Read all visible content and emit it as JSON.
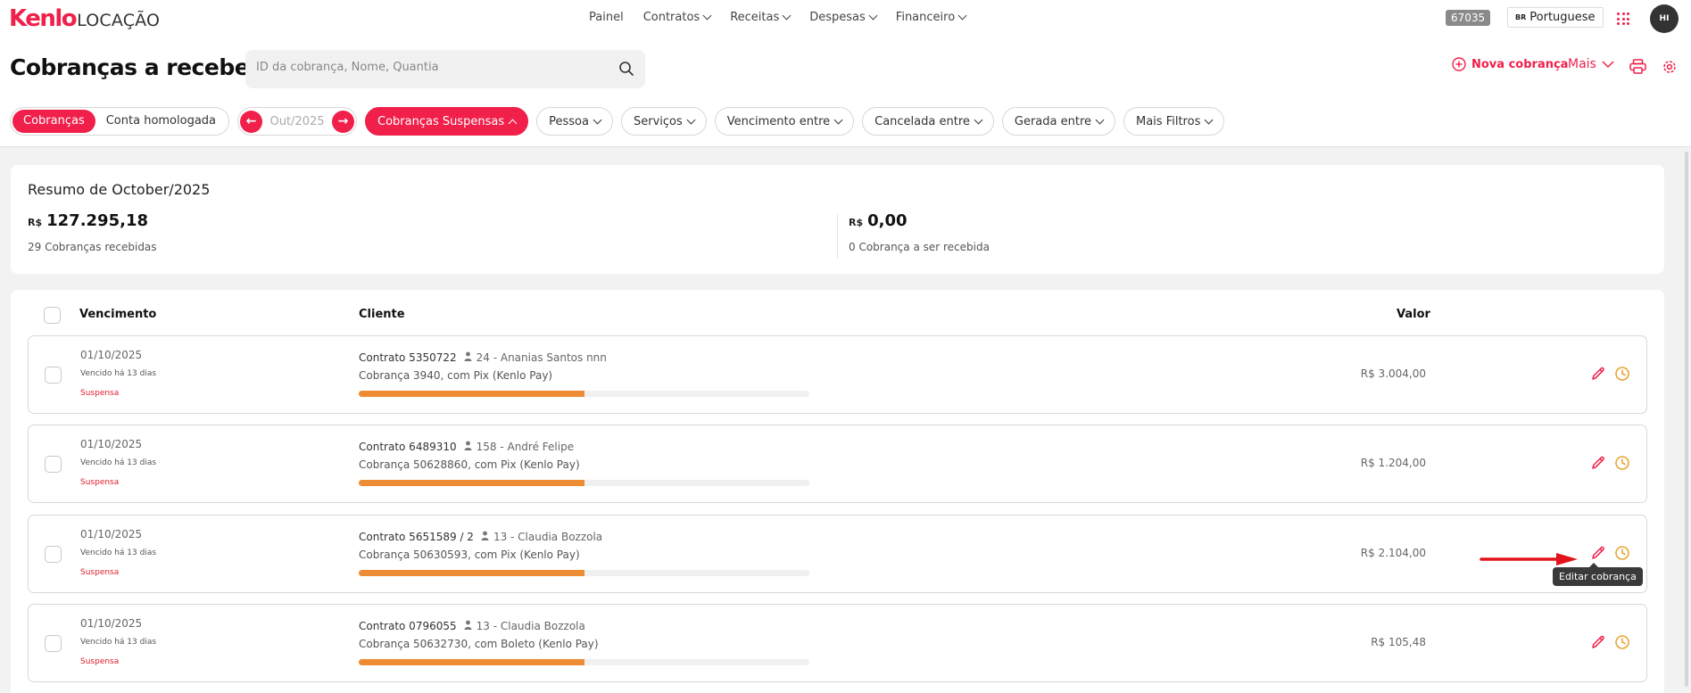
{
  "app": {
    "logo_brand": "Kenlo",
    "logo_product": "LOCAÇÃO"
  },
  "nav": [
    {
      "label": "Painel"
    },
    {
      "label": "Contratos"
    },
    {
      "label": "Receitas"
    },
    {
      "label": "Despesas"
    },
    {
      "label": "Financeiro"
    }
  ],
  "topbar": {
    "id_badge": "67035",
    "language_code": "BR",
    "language": "Portuguese",
    "user_initials": "HI"
  },
  "page": {
    "title": "Cobranças a receber",
    "search_placeholder": "ID da cobrança, Nome, Quantia",
    "new_charge": "Nova cobrança",
    "more": "Mais"
  },
  "filters": {
    "toggle": [
      "Cobranças",
      "Conta homologada"
    ],
    "period": "Out/2025",
    "suspended": "Cobranças Suspensas",
    "dropdowns": [
      "Pessoa",
      "Serviços",
      "Vencimento entre",
      "Cancelada entre",
      "Gerada entre",
      "Mais Filtros"
    ]
  },
  "summary": {
    "title": "Resumo de October/2025",
    "received": {
      "currency": "R$",
      "amount": "127.295,18",
      "caption": "29 Cobranças recebidas"
    },
    "pending": {
      "currency": "R$",
      "amount": "0,00",
      "caption": "0 Cobrança a ser recebida"
    }
  },
  "table": {
    "columns": {
      "due": "Vencimento",
      "client": "Cliente",
      "value": "Valor"
    },
    "rows": [
      {
        "date": "01/10/2025",
        "overdue": "Vencido há 13 dias",
        "status": "Suspensa",
        "contract": "Contrato 5350722",
        "client": "24 - Ananias Santos nnn",
        "charge": "Cobrança 3940, com Pix (Kenlo Pay)",
        "amount": "R$ 3.004,00",
        "progress": 0.5
      },
      {
        "date": "01/10/2025",
        "overdue": "Vencido há 13 dias",
        "status": "Suspensa",
        "contract": "Contrato 6489310",
        "client": "158 - André Felipe",
        "charge": "Cobrança 50628860, com Pix (Kenlo Pay)",
        "amount": "R$ 1.204,00",
        "progress": 0.5
      },
      {
        "date": "01/10/2025",
        "overdue": "Vencido há 13 dias",
        "status": "Suspensa",
        "contract": "Contrato 5651589 / 2",
        "client": "13 - Claudia Bozzola",
        "charge": "Cobrança 50630593, com Pix (Kenlo Pay)",
        "amount": "R$ 2.104,00",
        "progress": 0.5
      },
      {
        "date": "01/10/2025",
        "overdue": "Vencido há 13 dias",
        "status": "Suspensa",
        "contract": "Contrato 0796055",
        "client": "13 - Claudia Bozzola",
        "charge": "Cobrança 50632730, com Boleto (Kenlo Pay)",
        "amount": "R$ 105,48",
        "progress": 0.5
      }
    ]
  },
  "tooltip": "Editar cobrança",
  "colors": {
    "accent": "#f0204b",
    "progress": "#ee8c35",
    "status_suspended": "#e0202e",
    "clock": "#e7a531"
  }
}
